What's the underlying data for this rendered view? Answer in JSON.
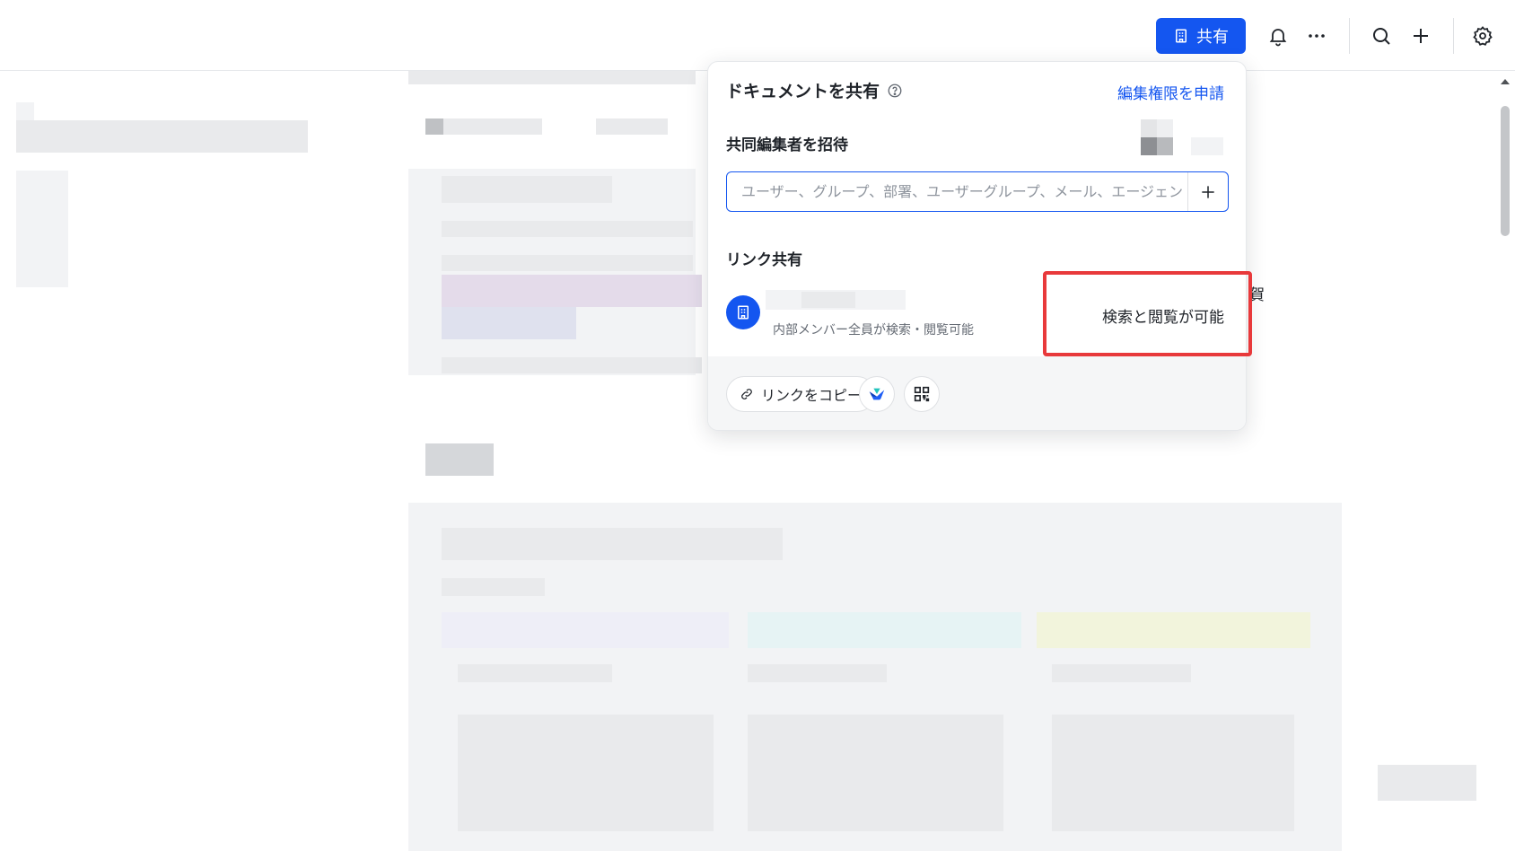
{
  "topbar": {
    "share_label": "共有",
    "colors": {
      "accent": "#1456f0"
    }
  },
  "share_popover": {
    "title": "ドキュメントを共有",
    "request_edit_link": "編集権限を申請",
    "invite_label": "共同編集者を招待",
    "search_placeholder": "ユーザー、グループ、部署、ユーザーグループ、メール、エージェントを検索",
    "link_sharing_label": "リンク共有",
    "link_description": "内部メンバー全員が検索・閲覧可能",
    "permission_value": "検索と閲覧が可能",
    "copy_link_label": "リンクをコピー"
  },
  "background": {
    "peek_char": "賀"
  },
  "highlight_color": "#e8393b"
}
